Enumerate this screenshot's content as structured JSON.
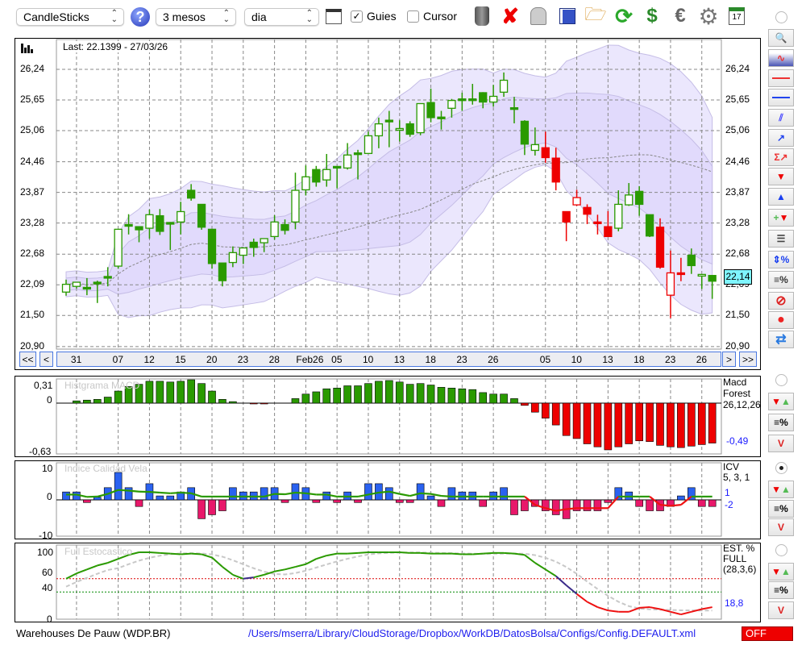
{
  "toolbar": {
    "chart_type": "CandleSticks",
    "period": "3 mesos",
    "interval": "dia",
    "guides_label": "Guies",
    "guides_checked": true,
    "cursor_label": "Cursor",
    "cursor_checked": false,
    "icons": [
      "trash-icon",
      "delete-icon",
      "lamp-icon",
      "save-icon",
      "folder-open-icon",
      "refresh-icon",
      "sync-icon",
      "euro-icon",
      "gear-icon",
      "calendar-icon"
    ],
    "calendar_day": "17"
  },
  "main": {
    "last": "Last: 22.1399 - 27/03/26",
    "price_tag": "22,14",
    "price_labels": [
      "26,24",
      "25,65",
      "25,06",
      "24,46",
      "23,87",
      "23,28",
      "22,68",
      "22,09",
      "21,50",
      "20,90"
    ],
    "nav": {
      "first": "<<",
      "prev": "<",
      "next": ">",
      "last": ">>"
    }
  },
  "macd": {
    "title": "Histgrama MACD",
    "name": [
      "Macd",
      "Forest",
      "26,12,26"
    ],
    "value": "-0,49",
    "ticks": [
      "0,31",
      "0",
      "-0,63"
    ]
  },
  "icv": {
    "title": "Indice Calidad Vela",
    "name": [
      "ICV",
      "5, 3, 1"
    ],
    "value1": "1",
    "value2": "-2",
    "ticks": [
      "10",
      "0",
      "-10"
    ]
  },
  "stoch": {
    "title": "Full Estocastico",
    "name": [
      "EST. %",
      "FULL",
      "(28,3,6)"
    ],
    "value": "18,8",
    "ticks": [
      "100",
      "60",
      "40",
      "0"
    ]
  },
  "footer": {
    "ticker": "Warehouses De Pauw (WDP.BR)",
    "path": "/Users/mserra/Library/CloudStorage/Dropbox/WorkDB/DatosBolsa/Configs/Config.DEFAULT.xml",
    "status": "OFF"
  },
  "colors": {
    "up": "#2a9a00",
    "down": "#ee0000",
    "band_outer": "#ebe7fd",
    "band_inner": "#e1dafc",
    "band_edge": "#c5bde6",
    "tag": "#7ff5ff"
  },
  "chart_data": [
    {
      "type": "candlestick",
      "title": "Warehouses De Pauw (WDP.BR)",
      "ylim": [
        20.9,
        26.24
      ],
      "x_labels": [
        [
          "31",
          1
        ],
        [
          "07",
          5
        ],
        [
          "12",
          8
        ],
        [
          "15",
          11
        ],
        [
          "20",
          14
        ],
        [
          "23",
          17
        ],
        [
          "28",
          20
        ],
        [
          "Feb26",
          23
        ],
        [
          "05",
          26
        ],
        [
          "10",
          29
        ],
        [
          "13",
          32
        ],
        [
          "18",
          35
        ],
        [
          "23",
          38
        ],
        [
          "26",
          41
        ],
        [
          "05",
          46
        ],
        [
          "10",
          49
        ],
        [
          "13",
          52
        ],
        [
          "18",
          55
        ],
        [
          "23",
          58
        ],
        [
          "26",
          61
        ]
      ],
      "ohlc_fields": [
        "open",
        "high",
        "low",
        "close",
        "color"
      ],
      "ohlc": [
        [
          21.95,
          22.19,
          21.88,
          22.1,
          "g"
        ],
        [
          22.06,
          22.14,
          22.02,
          22.14,
          "g"
        ],
        [
          22.04,
          22.22,
          21.89,
          22.04,
          "g"
        ],
        [
          22.14,
          22.17,
          21.74,
          22.12,
          "g"
        ],
        [
          22.25,
          22.43,
          22.06,
          22.23,
          "g"
        ],
        [
          22.45,
          23.16,
          22.4,
          23.16,
          "g"
        ],
        [
          23.25,
          23.45,
          23.06,
          23.23,
          "g"
        ],
        [
          23.21,
          23.21,
          22.91,
          23.15,
          "g"
        ],
        [
          23.18,
          23.54,
          22.98,
          23.44,
          "g"
        ],
        [
          23.42,
          23.55,
          23.05,
          23.12,
          "g"
        ],
        [
          23.29,
          23.3,
          22.76,
          23.29,
          "g"
        ],
        [
          23.3,
          23.69,
          23.06,
          23.5,
          "g"
        ],
        [
          23.91,
          24.03,
          23.71,
          23.76,
          "g"
        ],
        [
          23.64,
          23.64,
          23.15,
          23.2,
          "g"
        ],
        [
          23.16,
          23.16,
          22.4,
          22.5,
          "g"
        ],
        [
          22.51,
          22.51,
          22.06,
          22.17,
          "g"
        ],
        [
          22.52,
          22.83,
          22.43,
          22.71,
          "g"
        ],
        [
          22.66,
          22.8,
          22.49,
          22.8,
          "g"
        ],
        [
          22.91,
          22.98,
          22.63,
          22.81,
          "g"
        ],
        [
          22.9,
          22.98,
          22.72,
          22.98,
          "g"
        ],
        [
          23.02,
          23.43,
          22.96,
          23.3,
          "g"
        ],
        [
          23.25,
          23.35,
          23.06,
          23.14,
          "g"
        ],
        [
          23.3,
          24.25,
          23.16,
          23.91,
          "g"
        ],
        [
          23.92,
          24.39,
          23.81,
          24.17,
          "g"
        ],
        [
          24.31,
          24.38,
          23.98,
          24.07,
          "g"
        ],
        [
          24.11,
          24.61,
          23.98,
          24.31,
          "g"
        ],
        [
          24.37,
          24.37,
          23.95,
          24.34,
          "g"
        ],
        [
          24.34,
          24.82,
          24.31,
          24.59,
          "g"
        ],
        [
          24.63,
          24.69,
          24.12,
          24.63,
          "g"
        ],
        [
          24.62,
          25.04,
          24.62,
          24.96,
          "g"
        ],
        [
          24.96,
          25.31,
          24.72,
          25.19,
          "g"
        ],
        [
          25.26,
          25.44,
          24.74,
          25.26,
          "g"
        ],
        [
          25.07,
          25.26,
          24.85,
          25.1,
          "g"
        ],
        [
          25.19,
          25.24,
          24.94,
          24.99,
          "g"
        ],
        [
          25.02,
          25.58,
          24.97,
          25.58,
          "g"
        ],
        [
          25.6,
          25.87,
          25.22,
          25.31,
          "g"
        ],
        [
          25.32,
          25.44,
          25.08,
          25.32,
          "g"
        ],
        [
          25.49,
          25.67,
          25.31,
          25.64,
          "g"
        ],
        [
          25.67,
          25.79,
          25.44,
          25.67,
          "g"
        ],
        [
          25.67,
          25.96,
          25.56,
          25.67,
          "g"
        ],
        [
          25.79,
          25.8,
          25.49,
          25.61,
          "g"
        ],
        [
          25.61,
          25.94,
          25.52,
          25.72,
          "g"
        ],
        [
          25.8,
          26.18,
          25.71,
          26.03,
          "g"
        ],
        [
          25.5,
          25.71,
          25.2,
          25.5,
          "g"
        ],
        [
          25.24,
          25.26,
          24.59,
          24.8,
          "g"
        ],
        [
          24.68,
          25.12,
          24.58,
          24.79,
          "g"
        ],
        [
          24.73,
          25.04,
          24.44,
          24.54,
          "r"
        ],
        [
          24.53,
          24.73,
          23.91,
          24.07,
          "r"
        ],
        [
          23.5,
          23.5,
          22.93,
          23.3,
          "r"
        ],
        [
          23.63,
          23.92,
          23.61,
          23.77,
          "r"
        ],
        [
          23.58,
          23.64,
          23.26,
          23.45,
          "r"
        ],
        [
          23.3,
          23.44,
          23.06,
          23.28,
          "r"
        ],
        [
          23.21,
          23.51,
          23.02,
          23.02,
          "r"
        ],
        [
          23.18,
          23.91,
          23.12,
          23.64,
          "g"
        ],
        [
          23.63,
          24.05,
          23.61,
          23.82,
          "g"
        ],
        [
          23.89,
          23.99,
          23.42,
          23.64,
          "g"
        ],
        [
          23.44,
          23.44,
          23.01,
          23.03,
          "g"
        ],
        [
          23.2,
          23.37,
          22.4,
          22.43,
          "r"
        ],
        [
          21.89,
          22.75,
          21.45,
          22.32,
          "r"
        ],
        [
          22.32,
          22.61,
          22.16,
          22.32,
          "r"
        ],
        [
          22.66,
          22.79,
          22.3,
          22.46,
          "g"
        ],
        [
          22.26,
          22.29,
          22.01,
          22.29,
          "g"
        ],
        [
          22.27,
          22.27,
          21.82,
          22.16,
          "g"
        ]
      ]
    },
    {
      "type": "bar",
      "title": "Histgrama MACD",
      "ylim": [
        -0.63,
        0.31
      ],
      "values": [
        0,
        0.03,
        0.04,
        0.05,
        0.08,
        0.16,
        0.22,
        0.25,
        0.29,
        0.29,
        0.28,
        0.29,
        0.31,
        0.26,
        0.16,
        0.05,
        0.02,
        0,
        -0.01,
        -0.01,
        0,
        0,
        0.06,
        0.12,
        0.15,
        0.19,
        0.2,
        0.23,
        0.23,
        0.26,
        0.29,
        0.3,
        0.28,
        0.25,
        0.26,
        0.24,
        0.21,
        0.2,
        0.19,
        0.18,
        0.14,
        0.12,
        0.12,
        0.06,
        -0.03,
        -0.12,
        -0.2,
        -0.29,
        -0.43,
        -0.47,
        -0.54,
        -0.58,
        -0.62,
        -0.58,
        -0.54,
        -0.5,
        -0.51,
        -0.56,
        -0.58,
        -0.59,
        -0.57,
        -0.55,
        -0.53
      ]
    },
    {
      "type": "bar",
      "title": "Indice Calidad Vela",
      "ylim": [
        -10,
        10
      ],
      "values": [
        2.4,
        2.4,
        -0.8,
        0.8,
        3.7,
        8.3,
        3.7,
        -2.0,
        4.9,
        1.2,
        1.2,
        2.4,
        3.7,
        -5.7,
        -4.5,
        -3.3,
        3.7,
        2.4,
        2.4,
        3.7,
        3.7,
        -0.8,
        4.9,
        3.7,
        -0.8,
        2.4,
        -0.8,
        2.4,
        -0.8,
        4.9,
        4.9,
        3.7,
        -0.8,
        -0.8,
        4.9,
        1.2,
        -2.0,
        3.7,
        2.4,
        2.4,
        -2.0,
        2.4,
        3.7,
        -4.5,
        -3.3,
        -2.0,
        -3.3,
        -4.5,
        -5.7,
        -3.3,
        -3.3,
        -3.3,
        -0.8,
        3.7,
        2.4,
        -2.0,
        -3.3,
        -3.3,
        -2.0,
        1.2,
        3.7,
        -2.0,
        -2.0
      ],
      "signal": [
        1.6,
        1.6,
        0.9,
        1.0,
        1.8,
        3.0,
        2.8,
        2.5,
        2.4,
        2.2,
        2.0,
        2.2,
        2.0,
        1.0,
        1.0,
        1.0,
        1.0,
        1.0,
        1.0,
        1.0,
        1.8,
        1.7,
        2.2,
        2.0,
        1.6,
        1.6,
        1.0,
        1.0,
        1.0,
        1.6,
        2.2,
        2.5,
        1.8,
        1.2,
        2.0,
        1.8,
        1.2,
        1.0,
        1.0,
        1.0,
        1.0,
        1.0,
        1.0,
        1.0,
        1.0,
        -1.5,
        -2.5,
        -3.3,
        -2.8,
        -2.5,
        -2.5,
        -2.5,
        -2.5,
        1.0,
        1.0,
        1.0,
        1.0,
        -1.5,
        -1.8,
        -1.5,
        1.0,
        1.0,
        1.0
      ]
    },
    {
      "type": "line",
      "title": "Full Estocastico",
      "ylim": [
        0,
        100
      ],
      "levels": [
        60,
        40
      ],
      "k": [
        60,
        68,
        74,
        80,
        84,
        90,
        96,
        100,
        100,
        99,
        98,
        97,
        98,
        97,
        92,
        78,
        66,
        60,
        62,
        66,
        71,
        74,
        78,
        82,
        90,
        95,
        98,
        98,
        99,
        100,
        100,
        100,
        100,
        99,
        99,
        98,
        98,
        98,
        97,
        97,
        98,
        99,
        99,
        98,
        96,
        84,
        74,
        64,
        50,
        37,
        25,
        17,
        12,
        10,
        10,
        16,
        17,
        14,
        10,
        6,
        10,
        14,
        17
      ]
    }
  ]
}
